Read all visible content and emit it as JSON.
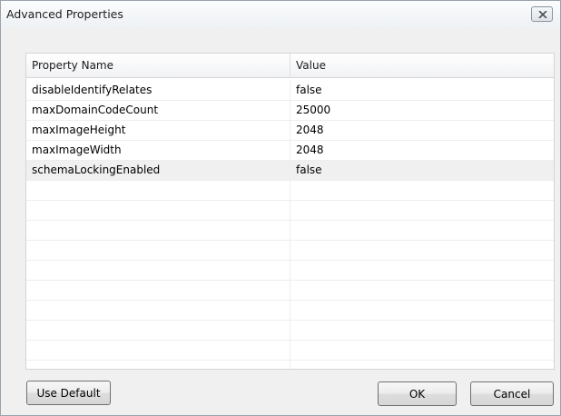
{
  "window": {
    "title": "Advanced Properties"
  },
  "grid": {
    "columns": [
      "Property Name",
      "Value"
    ],
    "rows": [
      {
        "name": "disableIdentifyRelates",
        "value": "false"
      },
      {
        "name": "maxDomainCodeCount",
        "value": "25000"
      },
      {
        "name": "maxImageHeight",
        "value": "2048"
      },
      {
        "name": "maxImageWidth",
        "value": "2048"
      },
      {
        "name": "schemaLockingEnabled",
        "value": "false"
      },
      {
        "name": "",
        "value": ""
      },
      {
        "name": "",
        "value": ""
      },
      {
        "name": "",
        "value": ""
      },
      {
        "name": "",
        "value": ""
      },
      {
        "name": "",
        "value": ""
      },
      {
        "name": "",
        "value": ""
      },
      {
        "name": "",
        "value": ""
      },
      {
        "name": "",
        "value": ""
      },
      {
        "name": "",
        "value": ""
      },
      {
        "name": "",
        "value": ""
      }
    ]
  },
  "buttons": {
    "use_default": "Use Default",
    "ok": "OK",
    "cancel": "Cancel"
  },
  "icons": {
    "close": "close-icon"
  }
}
